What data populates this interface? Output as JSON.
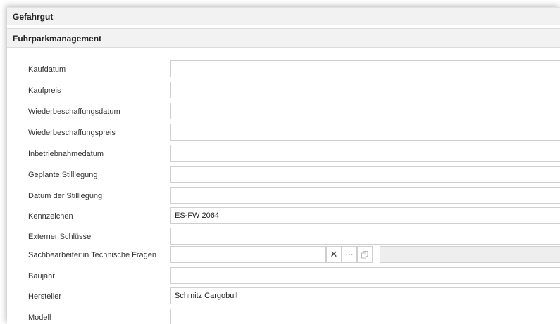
{
  "sections": {
    "gefahrgut": "Gefahrgut",
    "fuhrpark": "Fuhrparkmanagement"
  },
  "fields": {
    "kaufdatum": {
      "label": "Kaufdatum",
      "value": ""
    },
    "kaufpreis": {
      "label": "Kaufpreis",
      "value": ""
    },
    "wiederbeschaffungsdatum": {
      "label": "Wiederbeschaffungsdatum",
      "value": ""
    },
    "wiederbeschaffungspreis": {
      "label": "Wiederbeschaffungspreis",
      "value": ""
    },
    "inbetriebnahmedatum": {
      "label": "Inbetriebnahmedatum",
      "value": ""
    },
    "geplante_stilllegung": {
      "label": "Geplante Stilllegung",
      "value": ""
    },
    "datum_stilllegung": {
      "label": "Datum der Stilllegung",
      "value": ""
    },
    "kennzeichen": {
      "label": "Kennzeichen",
      "value": "ES-FW 2064"
    },
    "externer_schluessel": {
      "label": "Externer Schlüssel",
      "value": ""
    },
    "sachbearbeiter": {
      "label": "Sachbearbeiter:in Technische Fragen",
      "value": ""
    },
    "baujahr": {
      "label": "Baujahr",
      "value": ""
    },
    "hersteller": {
      "label": "Hersteller",
      "value": "Schmitz Cargobull"
    },
    "modell": {
      "label": "Modell",
      "value": ""
    }
  },
  "lookup_buttons": {
    "clear": "✕",
    "more": "···",
    "open_icon": "copy-icon"
  }
}
